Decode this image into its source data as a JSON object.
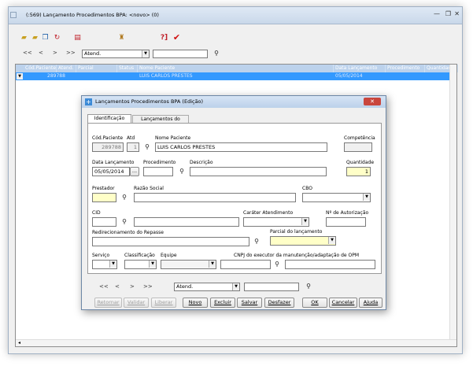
{
  "window": {
    "title": "(:569) Lançamento Procedimentos BPA: <novo> (0)",
    "minimize": "—",
    "restore": "❐",
    "close": "✕"
  },
  "toolbar": {
    "icons": [
      "open-icon",
      "open-alt-icon",
      "copy-icon",
      "refresh-icon",
      "report-icon",
      "print-icon",
      "help-icon",
      "check-icon"
    ],
    "help_text": "?]",
    "check_text": "✔"
  },
  "nav": {
    "first": "<<",
    "prev": "<",
    "next": ">",
    "last": ">>",
    "filter_value": "Atend.",
    "search_value": ""
  },
  "grid": {
    "columns": [
      "Cód.Paciente",
      "Atend.",
      "Parcial",
      "Status",
      "Nome Paciente",
      "Data Lançamento",
      "Procedimento",
      "Quantidade"
    ],
    "row": {
      "cod": "289788",
      "nome": "LUIS CARLOS PRESTES",
      "data": "05/05/2014"
    }
  },
  "dialog": {
    "title": "Lançamentos Procedimentos BPA (Edição)",
    "tabs": [
      "Identificação",
      "Lançamentos do Paciente"
    ],
    "labels": {
      "cod_paciente": "Cód.Paciente",
      "atd": "Atd",
      "nome_paciente": "Nome Paciente",
      "competencia": "Competência",
      "data_lancamento": "Data Lançamento",
      "procedimento": "Procedimento",
      "descricao": "Descrição",
      "quantidade": "Quantidade",
      "prestador": "Prestador",
      "razao_social": "Razão Social",
      "cbo": "CBO",
      "cid": "CID",
      "carater": "Caráter Atendimento",
      "autorizacao": "Nº de Autorização",
      "redirecionamento": "Redirecionamento do Repasse",
      "parcial": "Parcial do lançamento",
      "servico": "Serviço",
      "classificacao": "Classificação",
      "equipe": "Equipe",
      "cnpj": "CNPJ do executor da manutenção/adaptação de OPM"
    },
    "values": {
      "cod_paciente": "289788",
      "atd": "1",
      "nome_paciente": "LUIS CARLOS PRESTES",
      "data_lancamento": "05/05/2014",
      "quantidade": "1",
      "date_btn": "..."
    },
    "nav": {
      "first": "<<",
      "prev": "<",
      "next": ">",
      "last": ">>",
      "filter_value": "Atend."
    },
    "buttons": [
      "Retornar",
      "Validar",
      "Liberar",
      "Novo",
      "Excluir",
      "Salvar",
      "Desfazer",
      "OK",
      "Cancelar",
      "Ajuda"
    ],
    "close": "✕"
  },
  "statusbar": {
    "scroll_left": "◂"
  }
}
